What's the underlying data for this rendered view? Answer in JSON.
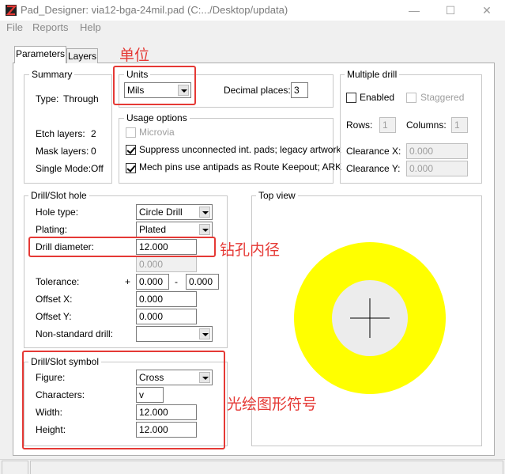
{
  "window": {
    "title": "Pad_Designer: via12-bga-24mil.pad (C:.../Desktop/updata)"
  },
  "menu": [
    "File",
    "Reports",
    "Help"
  ],
  "tabs": [
    "Parameters",
    "Layers"
  ],
  "summary": {
    "legend": "Summary",
    "type_label": "Type:",
    "type_value": "Through",
    "etch_label": "Etch layers:",
    "etch_value": "2",
    "mask_label": "Mask layers:",
    "mask_value": "0",
    "single_label": "Single Mode:",
    "single_value": "Off"
  },
  "units": {
    "legend": "Units",
    "value": "Mils",
    "decimal_label": "Decimal places:",
    "decimal_value": "3"
  },
  "usage": {
    "legend": "Usage options",
    "microvia": {
      "label": "Microvia",
      "checked": false,
      "enabled": false
    },
    "suppress": {
      "label": "Suppress unconnected int. pads; legacy artwork",
      "checked": true
    },
    "mech": {
      "label": "Mech pins use antipads as Route Keepout; ARK",
      "checked": true
    }
  },
  "multiple_drill": {
    "legend": "Multiple drill",
    "enabled_label": "Enabled",
    "staggered_label": "Staggered",
    "rows_label": "Rows:",
    "rows_value": "1",
    "columns_label": "Columns:",
    "columns_value": "1",
    "clearance_x_label": "Clearance X:",
    "clearance_x_value": "0.000",
    "clearance_y_label": "Clearance Y:",
    "clearance_y_value": "0.000"
  },
  "drill_hole": {
    "legend": "Drill/Slot hole",
    "hole_type_label": "Hole type:",
    "hole_type_value": "Circle Drill",
    "plating_label": "Plating:",
    "plating_value": "Plated",
    "diameter_label": "Drill diameter:",
    "diameter_value": "12.000",
    "secondary_value": "0.000",
    "tolerance_label": "Tolerance:",
    "tol_plus": "+",
    "tol_plus_value": "0.000",
    "tol_minus": "-",
    "tol_minus_value": "0.000",
    "offset_x_label": "Offset X:",
    "offset_x_value": "0.000",
    "offset_y_label": "Offset Y:",
    "offset_y_value": "0.000",
    "nonstandard_label": "Non-standard drill:",
    "nonstandard_value": ""
  },
  "drill_symbol": {
    "legend": "Drill/Slot symbol",
    "figure_label": "Figure:",
    "figure_value": "Cross",
    "chars_label": "Characters:",
    "chars_value": "v",
    "width_label": "Width:",
    "width_value": "12.000",
    "height_label": "Height:",
    "height_value": "12.000"
  },
  "top_view": {
    "legend": "Top view",
    "pad_color": "#ffff00",
    "hole_color": "#ececec"
  },
  "annotations": {
    "units_note": "单位",
    "diameter_note": "钻孔内径",
    "symbol_note": "光绘图形符号",
    "color": "#e53935"
  }
}
